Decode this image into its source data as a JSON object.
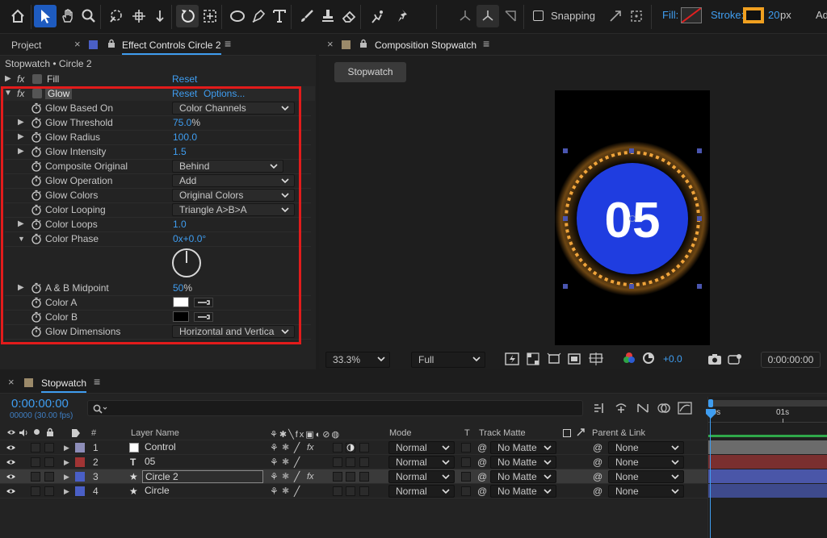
{
  "toolbar": {
    "snapping_label": "Snapping",
    "fill_label": "Fill:",
    "stroke_label": "Stroke:",
    "stroke_width": "20",
    "stroke_unit": "px",
    "add_label": "Ad",
    "accent": "#1e5bbf",
    "stroke_color": "#f0a020"
  },
  "left_panel": {
    "tab_project": "Project",
    "tab_effect_controls": "Effect Controls Circle 2",
    "breadcrumb": "Stopwatch • Circle 2",
    "fill_effect": {
      "name": "Fill",
      "reset": "Reset"
    },
    "glow_effect": {
      "name": "Glow",
      "reset": "Reset",
      "options": "Options..."
    },
    "properties": [
      {
        "label": "Glow Based On",
        "value": "Color Channels"
      },
      {
        "label": "Glow Threshold",
        "value": "75.0",
        "suffix": "%"
      },
      {
        "label": "Glow Radius",
        "value": "100.0"
      },
      {
        "label": "Glow Intensity",
        "value": "1.5"
      },
      {
        "label": "Composite Original",
        "value": "Behind"
      },
      {
        "label": "Glow Operation",
        "value": "Add"
      },
      {
        "label": "Glow Colors",
        "value": "Original Colors"
      },
      {
        "label": "Color Looping",
        "value": "Triangle A>B>A"
      },
      {
        "label": "Color Loops",
        "value": "1.0"
      },
      {
        "label": "Color Phase",
        "value": "0x+0.0°"
      },
      {
        "label": "A & B Midpoint",
        "value": "50",
        "suffix": "%"
      },
      {
        "label": "Color A",
        "value": "#ffffff"
      },
      {
        "label": "Color B",
        "value": "#000000"
      },
      {
        "label": "Glow Dimensions",
        "value": "Horizontal and Vertica"
      }
    ]
  },
  "composition": {
    "tab_title": "Composition Stopwatch",
    "comp_button": "Stopwatch",
    "display_number": "05",
    "zoom": "33.3%",
    "resolution": "Full",
    "exposure": "+0.0",
    "timecode": "0:00:00:00",
    "circle_color": "#1f3de0",
    "ring_color": "#f0a43a"
  },
  "timeline": {
    "tab_title": "Stopwatch",
    "current_time": "0:00:00:00",
    "frame_info": "00000 (30.00 fps)",
    "search_placeholder": "",
    "col_number": "#",
    "col_layer_name": "Layer Name",
    "col_mode": "Mode",
    "col_t": "T",
    "col_track_matte": "Track Matte",
    "col_parent": "Parent & Link",
    "ruler_start": "00s",
    "ruler_1s": "01s",
    "layers": [
      {
        "num": "1",
        "name": "Control",
        "mode": "Normal",
        "matte": "No Matte",
        "parent": "None",
        "label_color": "#8d8db8",
        "bar_color": "#6b6b6b"
      },
      {
        "num": "2",
        "name": "05",
        "mode": "Normal",
        "matte": "No Matte",
        "parent": "None",
        "label_color": "#a13434",
        "bar_color": "#7a2f2f"
      },
      {
        "num": "3",
        "name": "Circle 2",
        "mode": "Normal",
        "matte": "No Matte",
        "parent": "None",
        "label_color": "#4a5fc6",
        "bar_color": "#4a56a8"
      },
      {
        "num": "4",
        "name": "Circle",
        "mode": "Normal",
        "matte": "No Matte",
        "parent": "None",
        "label_color": "#4a5fc6",
        "bar_color": "#3e4a8c"
      }
    ]
  }
}
